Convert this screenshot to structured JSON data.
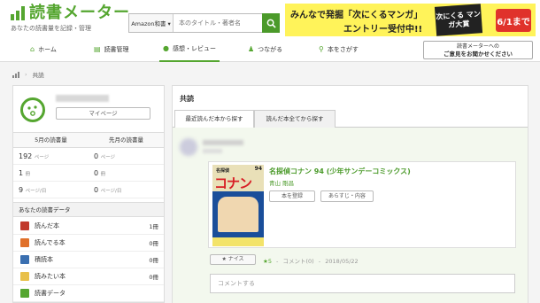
{
  "header": {
    "logo_text": "読書メーター",
    "tagline": "あなたの読書量を記録・管理",
    "search_select": "Amazon和書 ▾",
    "search_placeholder": "本のタイトル・著者名",
    "banner_line1": "みんなで発掘「次にくるマンガ」",
    "banner_line2": "エントリー受付中!!",
    "banner_logo": "次にくる マンガ大賞",
    "banner_date": "6/1まで"
  },
  "nav": {
    "items": [
      {
        "label": "ホーム",
        "icon": "home-icon"
      },
      {
        "label": "読書管理",
        "icon": "book-icon"
      },
      {
        "label": "感想・レビュー",
        "icon": "chat-icon"
      },
      {
        "label": "つながる",
        "icon": "people-icon"
      },
      {
        "label": "本をさがす",
        "icon": "search-icon"
      }
    ],
    "feedback_line1": "読書メーターへの",
    "feedback_line2": "ご意見をお聞かせください"
  },
  "breadcrumb": {
    "current": "共読"
  },
  "sidebar": {
    "mypage_label": "マイページ",
    "stats_headers": [
      "5月の読書量",
      "先月の読書量"
    ],
    "stats": [
      {
        "this_month": "192",
        "last_month": "0",
        "unit": "ページ"
      },
      {
        "this_month": "1",
        "last_month": "0",
        "unit": "冊"
      },
      {
        "this_month": "9",
        "last_month": "0",
        "unit": "ページ/日"
      }
    ],
    "data_title": "あなたの読書データ",
    "data_rows": [
      {
        "label": "読んだ本",
        "count": "1冊",
        "color": "#c1392b"
      },
      {
        "label": "読んでる本",
        "count": "0冊",
        "color": "#e0702a"
      },
      {
        "label": "積読本",
        "count": "0冊",
        "color": "#3a6fb0"
      },
      {
        "label": "読みたい本",
        "count": "0冊",
        "color": "#e8c04a"
      },
      {
        "label": "読書データ",
        "count": "",
        "color": "#55a630"
      }
    ]
  },
  "main": {
    "title": "共読",
    "tabs": [
      "最近読んだ本から探す",
      "読んだ本全てから探す"
    ],
    "book": {
      "title": "名探偵コナン 94 (少年サンデーコミックス)",
      "author": "青山 剛昌",
      "cover_series": "名探偵",
      "cover_title": "コナン",
      "cover_num": "94",
      "register_label": "本を登録",
      "summary_label": "あらすじ・内容"
    },
    "nice_label": "★ ナイス",
    "stars": "★5",
    "comment_meta": "コメント(0)",
    "date": "2018/05/22",
    "comment_placeholder": "コメントする"
  },
  "colors": {
    "brand": "#55a630",
    "accent_red": "#e0322b",
    "banner": "#fff35a"
  }
}
